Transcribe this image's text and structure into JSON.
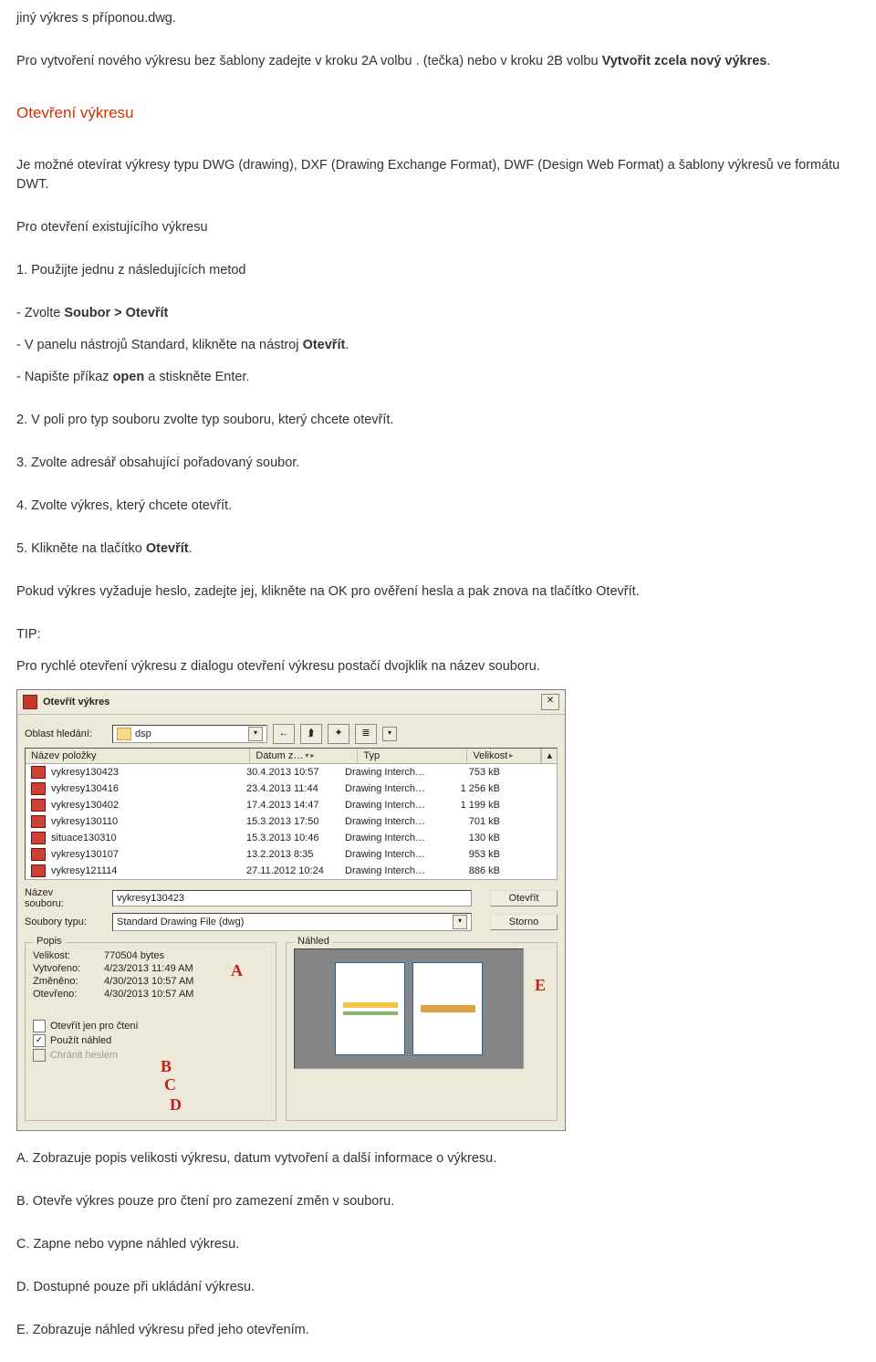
{
  "doc": {
    "line1": "jiný výkres s příponou.dwg.",
    "p1a": "Pro vytvoření nového výkresu bez šablony zadejte v kroku 2A volbu ",
    "p1b": ". (tečka) nebo v kroku 2B volbu ",
    "p1c_bold": "Vytvořit zcela nový výkres",
    "p1d": ".",
    "h_red": "Otevření výkresu",
    "p2": "Je možné otevírat výkresy typu DWG (drawing), DXF (Drawing Exchange Format), DWF (Design Web Format) a šablony výkresů ve formátu DWT.",
    "p3": "Pro otevření existujícího výkresu",
    "p4": "1. Použijte jednu z následujících metod",
    "b1a": "- Zvolte ",
    "b1b_bold": "Soubor > Otevřít",
    "b2a": "- V panelu nástrojů Standard, klikněte na nástroj ",
    "b2b_bold": "Otevřít",
    "b2c": ".",
    "b3a": "- Napište příkaz ",
    "b3b_bold": "open",
    "b3c": " a stiskněte Enter.",
    "p5": "2. V poli pro typ souboru zvolte typ souboru, který chcete otevřít.",
    "p6": "3. Zvolte adresář obsahující pořadovaný soubor.",
    "p7": "4. Zvolte výkres, který chcete otevřít.",
    "p8a": "5. Klikněte na tlačítko ",
    "p8b_bold": "Otevřít",
    "p8c": ".",
    "p9": "Pokud výkres vyžaduje heslo, zadejte jej, klikněte na OK pro ověření hesla a pak znova na tlačítko Otevřít.",
    "tip_lbl": "TIP:",
    "tip": "Pro rychlé otevření výkresu z dialogu otevření výkresu postačí dvojklik na název souboru.",
    "legA": "A. Zobrazuje popis velikosti výkresu, datum vytvoření a další informace o výkresu.",
    "legB": "B. Otevře výkres pouze pro čtení pro zamezení změn v souboru.",
    "legC": "C. Zapne nebo vypne náhled výkresu.",
    "legD": "D. Dostupné pouze při ukládání výkresu.",
    "legE": "E. Zobrazuje náhled výkresu před jeho otevřením."
  },
  "dlg": {
    "title": "Otevřít výkres",
    "search_lbl": "Oblast hledání:",
    "folder": "dsp",
    "hdr_name": "Název položky",
    "hdr_date": "Datum z…",
    "hdr_type": "Typ",
    "hdr_size": "Velikost",
    "rows": [
      {
        "n": "vykresy130423",
        "d": "30.4.2013 10:57",
        "t": "Drawing Interch…",
        "s": "753 kB"
      },
      {
        "n": "vykresy130416",
        "d": "23.4.2013 11:44",
        "t": "Drawing Interch…",
        "s": "1 256 kB"
      },
      {
        "n": "vykresy130402",
        "d": "17.4.2013 14:47",
        "t": "Drawing Interch…",
        "s": "1 199 kB"
      },
      {
        "n": "vykresy130110",
        "d": "15.3.2013 17:50",
        "t": "Drawing Interch…",
        "s": "701 kB"
      },
      {
        "n": "situace130310",
        "d": "15.3.2013 10:46",
        "t": "Drawing Interch…",
        "s": "130 kB"
      },
      {
        "n": "vykresy130107",
        "d": "13.2.2013 8:35",
        "t": "Drawing Interch…",
        "s": "953 kB"
      },
      {
        "n": "vykresy121114",
        "d": "27.11.2012 10:24",
        "t": "Drawing Interch…",
        "s": "886 kB"
      }
    ],
    "fname_lbl1": "Název",
    "fname_lbl2": "souboru:",
    "fname_val": "vykresy130423",
    "ftype_lbl": "Soubory typu:",
    "ftype_val": "Standard Drawing File (dwg)",
    "btn_open": "Otevřít",
    "btn_cancel": "Storno",
    "g_popis": "Popis",
    "g_nahled": "Náhled",
    "k_size": "Velikost:",
    "v_size": "770504 bytes",
    "k_created": "Vytvořeno:",
    "v_created": "4/23/2013 11:49 AM",
    "k_modified": "Změněno:",
    "v_modified": "4/30/2013 10:57 AM",
    "k_opened": "Otevřeno:",
    "v_opened": "4/30/2013 10:57 AM",
    "c_readonly": "Otevřít jen pro čtení",
    "c_preview": "Použít náhled",
    "c_protect": "Chránit heslem",
    "mA": "A",
    "mB": "B",
    "mC": "C",
    "mD": "D",
    "mE": "E"
  }
}
